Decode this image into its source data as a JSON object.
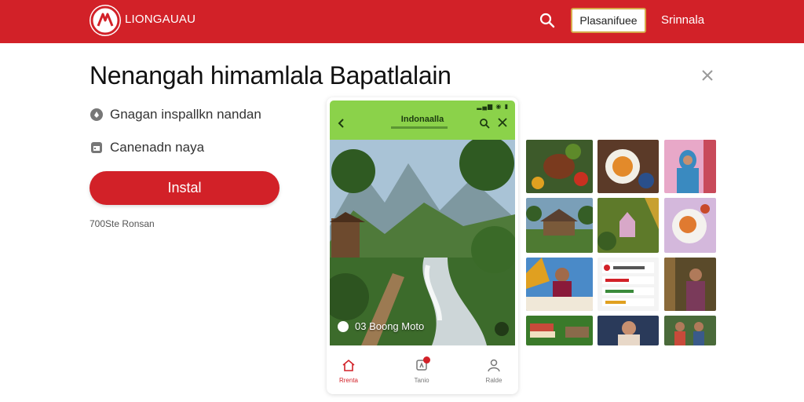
{
  "header": {
    "brand": "LIONGAUAU",
    "search_icon": "search-icon",
    "primary_button": "Plasanifuee",
    "signin": "Srinnala"
  },
  "main": {
    "headline": "Nenangah himamlala Bapatlalain",
    "features": [
      {
        "icon": "shield-icon",
        "text": "Gnagan inspallkn nandan"
      },
      {
        "icon": "calendar-icon",
        "text": "Canenadn naya"
      }
    ],
    "install_label": "Instal",
    "downloads_text": "700Ste Ronsan"
  },
  "phone": {
    "title": "Indonaalla",
    "hero_caption": "03 Boong Moto",
    "nav": [
      {
        "icon": "home-icon",
        "label": "Rrenta"
      },
      {
        "icon": "bookmark-icon",
        "label": "Tanio"
      },
      {
        "icon": "user-icon",
        "label": "Ralde"
      }
    ]
  },
  "colors": {
    "brand_red": "#d22128",
    "phone_header_green": "#8bd24a",
    "button_border_gold": "#d6a94a"
  }
}
